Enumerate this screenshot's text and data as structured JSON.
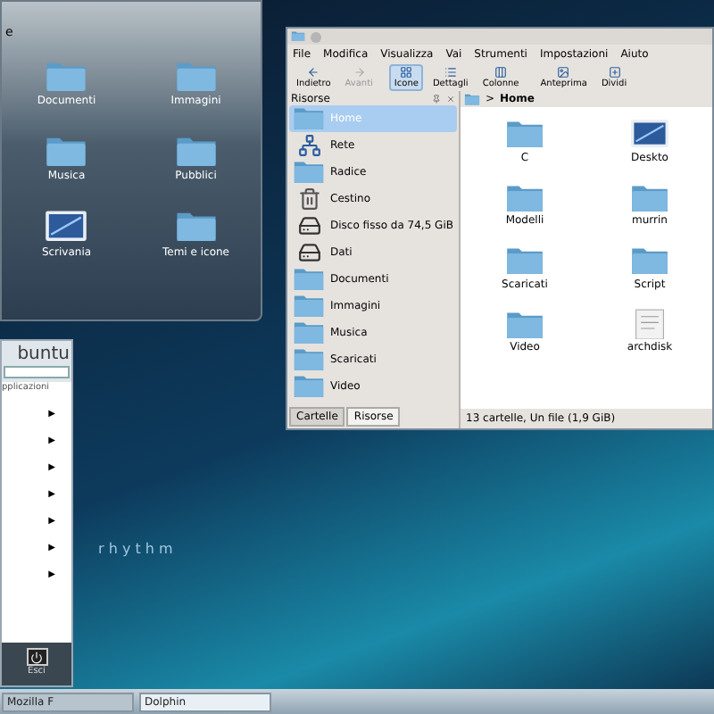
{
  "folder_view": {
    "title": "e",
    "items": [
      {
        "label": "Documenti",
        "kind": "folder"
      },
      {
        "label": "Immagini",
        "kind": "folder"
      },
      {
        "label": "Musica",
        "kind": "folder"
      },
      {
        "label": "Pubblici",
        "kind": "folder"
      },
      {
        "label": "Scrivania",
        "kind": "desktop"
      },
      {
        "label": "Temi e icone",
        "kind": "folder"
      }
    ]
  },
  "dolphin": {
    "menu": [
      "File",
      "Modifica",
      "Visualizza",
      "Vai",
      "Strumenti",
      "Impostazioni",
      "Aiuto"
    ],
    "toolbar": [
      {
        "label": "Indietro",
        "kind": "back",
        "disabled": false,
        "selected": false
      },
      {
        "label": "Avanti",
        "kind": "forward",
        "disabled": true,
        "selected": false
      },
      {
        "label": "Icone",
        "kind": "icons",
        "disabled": false,
        "selected": true
      },
      {
        "label": "Dettagli",
        "kind": "details",
        "disabled": false,
        "selected": false
      },
      {
        "label": "Colonne",
        "kind": "columns",
        "disabled": false,
        "selected": false
      },
      {
        "label": "Anteprima",
        "kind": "preview",
        "disabled": false,
        "selected": false
      },
      {
        "label": "Dividi",
        "kind": "split",
        "disabled": false,
        "selected": false
      }
    ],
    "places": {
      "title": "Risorse",
      "items": [
        {
          "label": "Home",
          "kind": "folder",
          "selected": true
        },
        {
          "label": "Rete",
          "kind": "network",
          "selected": false
        },
        {
          "label": "Radice",
          "kind": "folder",
          "selected": false
        },
        {
          "label": "Cestino",
          "kind": "trash",
          "selected": false
        },
        {
          "label": "Disco fisso da 74,5 GiB",
          "kind": "drive",
          "selected": false
        },
        {
          "label": "Dati",
          "kind": "drive",
          "selected": false
        },
        {
          "label": "Documenti",
          "kind": "folder",
          "selected": false
        },
        {
          "label": "Immagini",
          "kind": "folder",
          "selected": false
        },
        {
          "label": "Musica",
          "kind": "folder",
          "selected": false
        },
        {
          "label": "Scaricati",
          "kind": "folder",
          "selected": false
        },
        {
          "label": "Video",
          "kind": "folder",
          "selected": false
        }
      ]
    },
    "breadcrumb_separator": ">",
    "breadcrumb": "Home",
    "files": [
      {
        "name": "C",
        "kind": "folder"
      },
      {
        "name": "Deskto",
        "kind": "desktop"
      },
      {
        "name": "Modelli",
        "kind": "folder"
      },
      {
        "name": "murrin",
        "kind": "folder"
      },
      {
        "name": "Scaricati",
        "kind": "folder"
      },
      {
        "name": "Script",
        "kind": "folder"
      },
      {
        "name": "Video",
        "kind": "folder"
      },
      {
        "name": "archdisk",
        "kind": "file"
      }
    ],
    "status": "13 cartelle, Un file (1,9 GiB)",
    "panel_tabs": [
      {
        "label": "Cartelle",
        "selected": false
      },
      {
        "label": "Risorse",
        "selected": true
      }
    ]
  },
  "launcher": {
    "logo": "buntu",
    "section": "pplicazioni",
    "arrows": [
      "▶",
      "▶",
      "▶",
      "▶",
      "▶",
      "▶",
      "▶"
    ],
    "leave": "Esci"
  },
  "wallpaper_text": "r h y t h m",
  "taskbar": {
    "tasks": [
      {
        "label": "Mozilla F",
        "selected": false
      },
      {
        "label": "Dolphin",
        "selected": true
      }
    ]
  }
}
